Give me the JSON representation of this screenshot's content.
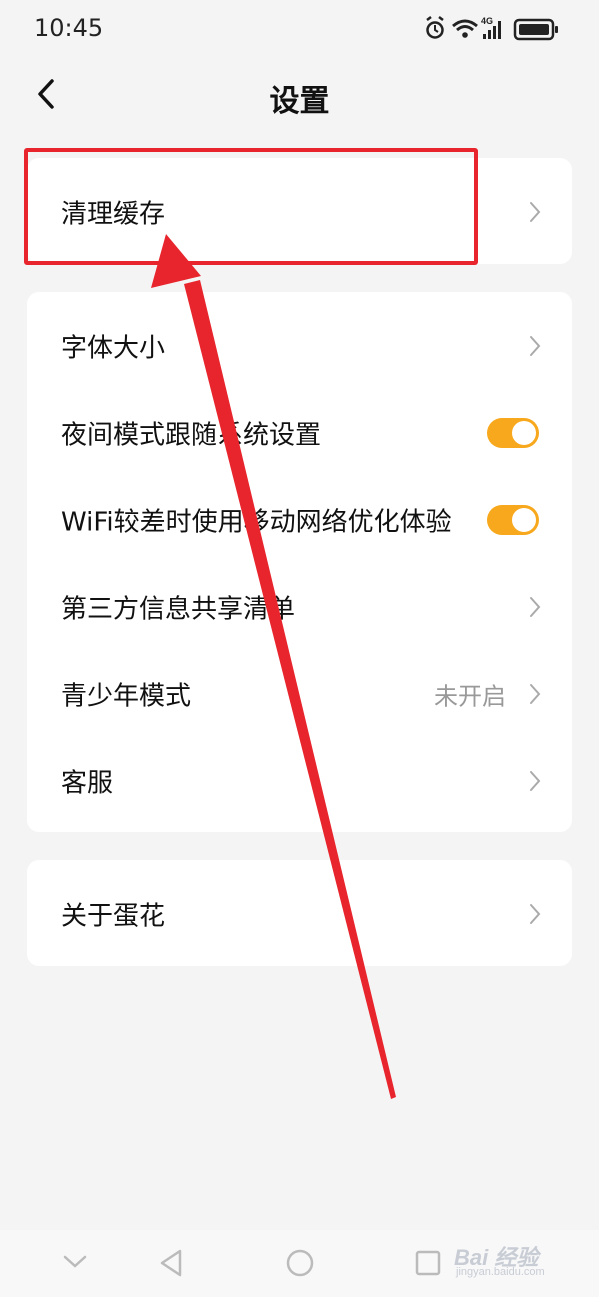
{
  "status_bar": {
    "time": "10:45",
    "icons": [
      "alarm-icon",
      "wifi-icon",
      "signal-4g-icon",
      "battery-icon"
    ],
    "network_label": "4G"
  },
  "header": {
    "title": "设置",
    "back_icon": "chevron-left-icon"
  },
  "groups": [
    {
      "items": [
        {
          "label": "清理缓存",
          "control": "chevron"
        }
      ]
    },
    {
      "items": [
        {
          "label": "字体大小",
          "control": "chevron"
        },
        {
          "label": "夜间模式跟随系统设置",
          "control": "toggle",
          "on": true
        },
        {
          "label": "WiFi较差时使用移动网络优化体验",
          "control": "toggle",
          "on": true
        },
        {
          "label": "第三方信息共享清单",
          "control": "chevron"
        },
        {
          "label": "青少年模式",
          "control": "chevron",
          "value": "未开启"
        },
        {
          "label": "客服",
          "control": "chevron"
        }
      ]
    },
    {
      "items": [
        {
          "label": "关于蛋花",
          "control": "chevron"
        }
      ]
    }
  ],
  "annotation": {
    "highlight_color": "#e8252d",
    "arrow_color": "#e8252d"
  },
  "nav_bar": {
    "buttons": [
      "collapse-icon",
      "back-triangle-icon",
      "home-circle-icon",
      "recents-square-icon"
    ]
  },
  "watermark": {
    "text": "Bai 经验",
    "subtext": "jingyan.baidu.com"
  },
  "colors": {
    "background": "#f4f4f4",
    "card": "#ffffff",
    "toggle_on": "#f7a81c",
    "secondary_text": "#999999"
  }
}
